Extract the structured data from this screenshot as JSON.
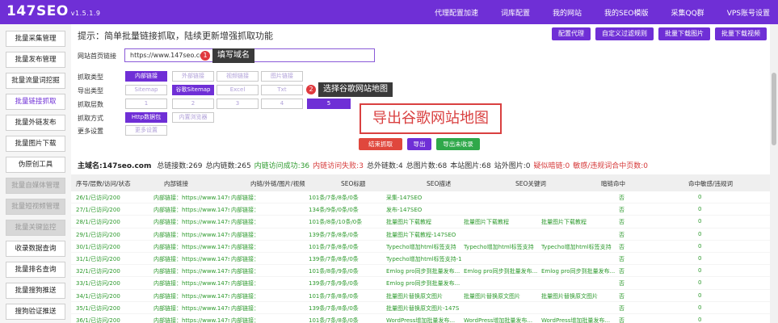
{
  "header": {
    "logo": "147SEO",
    "version": "v1.5.1.9",
    "nav": [
      "代理配置加速",
      "词库配置",
      "我的网站",
      "我的SEO模版",
      "采集QQ群",
      "VPS账号设置"
    ]
  },
  "sidebar": {
    "items": [
      {
        "label": "批量采集管理",
        "state": "normal"
      },
      {
        "label": "批量发布管理",
        "state": "normal"
      },
      {
        "label": "批量流量词挖掘",
        "state": "normal"
      },
      {
        "label": "批量链接抓取",
        "state": "active"
      },
      {
        "label": "批量外链发布",
        "state": "normal"
      },
      {
        "label": "批量图片下载",
        "state": "normal"
      },
      {
        "label": "伪原创工具",
        "state": "normal"
      },
      {
        "label": "批量自媒体管理",
        "state": "disabled"
      },
      {
        "label": "批量短视频管理",
        "state": "disabled"
      },
      {
        "label": "批量关键监控",
        "state": "disabled"
      },
      {
        "label": "收录数据查询",
        "state": "normal"
      },
      {
        "label": "批量排名查询",
        "state": "normal"
      },
      {
        "label": "批量搜狗推送",
        "state": "normal"
      },
      {
        "label": "搜狗验证推送",
        "state": "normal"
      }
    ]
  },
  "main": {
    "hint": "提示：简单批量链接抓取，陆续更新增强抓取功能",
    "top_actions": [
      "配置代理",
      "自定义过滤规则",
      "批量下载图片",
      "批量下载视频"
    ],
    "form": {
      "url_label": "网站首页链接",
      "url_value": "https://www.147seo.com",
      "tip1_badge": "1",
      "tip1": "填写域名",
      "labels": [
        "抓取类型",
        "导出类型",
        "抓取层数",
        "抓取方式",
        "更多设置"
      ],
      "crawl_types": [
        "内部链接",
        "外部链接",
        "视频链接",
        "图片链接"
      ],
      "export_types": [
        "Sitemap",
        "谷歌Sitemap",
        "Excel",
        "Txt"
      ],
      "tip2_badge": "2",
      "tip2": "选择谷歌网站地图",
      "depths": [
        "1",
        "2",
        "3",
        "4",
        "5"
      ],
      "methods": [
        "Http数据包",
        "内置浏览器"
      ],
      "more": "更多设置",
      "callout": "导出谷歌网站地图",
      "actions": [
        "结束抓取",
        "导出",
        "导出未收录"
      ]
    },
    "summary": {
      "site": "主域名:147seo.com",
      "stats": [
        {
          "text": "总链接数:269",
          "c": ""
        },
        {
          "text": "总内链数:265",
          "c": ""
        },
        {
          "text": "内链访问成功:36",
          "c": "g"
        },
        {
          "text": "内链访问失败:3",
          "c": "r"
        },
        {
          "text": "总外链数:4",
          "c": ""
        },
        {
          "text": "总图片数:68",
          "c": ""
        },
        {
          "text": "本站图片:68",
          "c": ""
        },
        {
          "text": "站外图片:0",
          "c": ""
        },
        {
          "text": "疑似暗链:0",
          "c": "r"
        },
        {
          "text": "敏感/违规词合中页数:0",
          "c": "r"
        }
      ]
    },
    "table": {
      "columns": [
        "序号/层数/访问/状态",
        "内部链接",
        "内链/外链/图片/视频",
        "SEO标题",
        "SEO描述",
        "SEO关键词",
        "暗链命中",
        "命中敏感/违规词"
      ],
      "rows": [
        [
          "26/1/已访问/200",
          "内部链接：https://www.147seo.co",
          "内部链接：",
          "101条/7条/8条/0条",
          "采集-147SEO",
          "",
          "",
          "否",
          "0"
        ],
        [
          "27/1/已访问/200",
          "内部链接：https://www.147seo.co",
          "内部链接：",
          "134条/9条/0条/0条",
          "发布-147SEO",
          "",
          "",
          "否",
          "0"
        ],
        [
          "28/1/已访问/200",
          "内部链接：https://www.147seo.co",
          "内部链接：",
          "101条/8条/10条/0条",
          "批量图片下载教程",
          "批量图片下载教程",
          "批量图片下载教程",
          "否",
          "0"
        ],
        [
          "29/1/已访问/200",
          "内部链接：https://www.147seo.co",
          "内部链接：",
          "139条/7条/8条/0条",
          "批量图片下载教程-147SEO",
          "",
          "",
          "否",
          "0"
        ],
        [
          "30/1/已访问/200",
          "内部链接：https://www.147seo.co",
          "内部链接：",
          "101条/7条/8条/0条",
          "Typecho增加html标签支持",
          "Typecho增加html标签支持",
          "Typecho增加html标签支持",
          "否",
          "0"
        ],
        [
          "31/1/已访问/200",
          "内部链接：https://www.147seo.co",
          "内部链接：",
          "139条/7条/8条/0条",
          "Typecho增加html标签支持-1",
          "",
          "",
          "否",
          "0"
        ],
        [
          "32/1/已访问/200",
          "内部链接：https://www.147seo.co",
          "内部链接：",
          "101条/8条/9条/0条",
          "Emlog pro同步到批量发布...",
          "Emlog pro同步到批量发布...",
          "Emlog pro同步到批量发布...",
          "否",
          "0"
        ],
        [
          "33/1/已访问/200",
          "内部链接：https://www.147seo.co",
          "内部链接：",
          "139条/7条/9条/0条",
          "Emlog pro同步到批量发布...",
          "",
          "",
          "否",
          "0"
        ],
        [
          "34/1/已访问/200",
          "内部链接：https://www.147seo.co",
          "内部链接：",
          "101条/7条/8条/0条",
          "批量图片替换原文图片",
          "批量图片替换原文图片",
          "批量图片替换原文图片",
          "否",
          "0"
        ],
        [
          "35/1/已访问/200",
          "内部链接：https://www.147seo.co",
          "内部链接：",
          "139条/7条/8条/0条",
          "批量图片替换原文图片-147S",
          "",
          "",
          "否",
          "0"
        ],
        [
          "36/1/已访问/200",
          "内部链接：https://www.147seo.co",
          "内部链接：",
          "101条/7条/8条/0条",
          "WordPress增加批量发布...",
          "WordPress增加批量发布...",
          "WordPress增加批量发布...",
          "否",
          "0"
        ]
      ]
    }
  }
}
